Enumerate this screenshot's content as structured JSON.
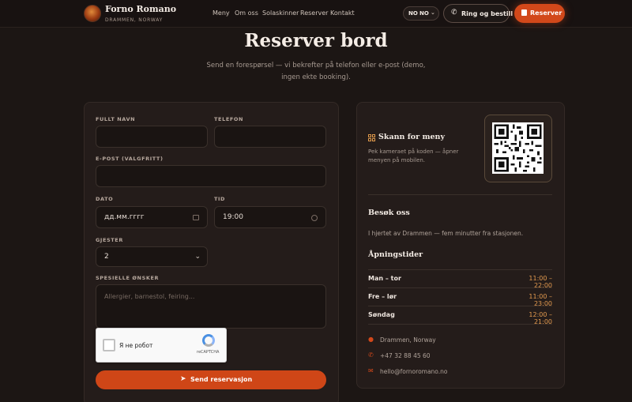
{
  "brand": {
    "name": "Forno Romano",
    "location": "DRAMMEN, NORWAY"
  },
  "nav": {
    "items": [
      "Meny",
      "Om oss",
      "Solaskinner",
      "Reserver",
      "Kontakt"
    ]
  },
  "header": {
    "lang_code": "NO",
    "lang_selected": "NO",
    "call_label": "Ring og bestill",
    "reserve_label": "Reserver"
  },
  "page": {
    "title": "Reserver bord",
    "subtitle": "Send en forespørsel — vi bekrefter på telefon eller e-post (demo, ingen ekte booking)."
  },
  "form": {
    "name_label": "FULLT NAVN",
    "phone_label": "TELEFON",
    "email_label": "E-POST (VALGFRITT)",
    "date_label": "DATO",
    "date_placeholder": "дд.мм.гггг",
    "time_label": "TID",
    "time_value": "19:00",
    "guests_label": "GJESTER",
    "guests_value": "2",
    "requests_label": "SPESIELLE ØNSKER",
    "requests_placeholder": "Allergier, barnestol, feiring...",
    "captcha_text": "Я не робот",
    "captcha_brand": "reCAPTCHA",
    "submit_label": "Send reservasjon"
  },
  "info": {
    "scan_title": "Skann for meny",
    "scan_desc": "Pek kameraet på koden — åpner menyen på mobilen.",
    "visit_title": "Besøk oss",
    "visit_desc": "I hjertet av Drammen — fem minutter fra stasjonen.",
    "hours_title": "Åpningstider",
    "hours": [
      {
        "day": "Man – tor",
        "time": "11:00 – 22:00"
      },
      {
        "day": "Fre – lør",
        "time": "11:00 – 23:00"
      },
      {
        "day": "Søndag",
        "time": "12:00 – 21:00"
      }
    ],
    "contacts": [
      {
        "icon": "location-pin-icon",
        "text": "Drammen, Norway"
      },
      {
        "icon": "phone-icon",
        "text": "+47 32 88 45 60"
      },
      {
        "icon": "mail-icon",
        "text": "hello@fornoromano.no"
      }
    ]
  },
  "colors": {
    "accent": "#d2481a",
    "hours_accent": "#e39a4f",
    "background": "#1c1614"
  }
}
